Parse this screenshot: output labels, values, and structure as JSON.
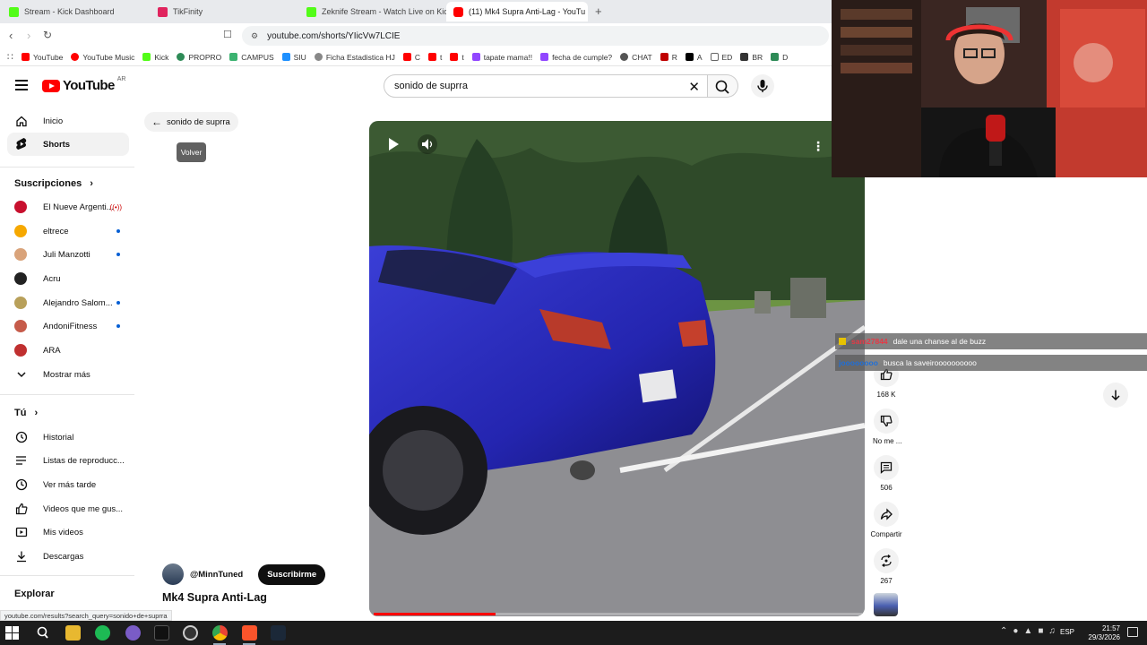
{
  "browser": {
    "tabs": [
      {
        "title": "Stream - Kick Dashboard",
        "favicon_color": "#1f1f1f"
      },
      {
        "title": "TikFinity",
        "favicon_color": "#e0245e"
      },
      {
        "title": "Zeknife Stream - Watch Live on Kick",
        "favicon_color": "#1f1f1f"
      },
      {
        "title": "(11) Mk4 Supra Anti-Lag - YouTu",
        "favicon_color": "#ff0000"
      }
    ],
    "url": "youtube.com/shorts/YIicVw7LCIE",
    "bookmarks": [
      {
        "label": "YouTube",
        "color": "#ff0000"
      },
      {
        "label": "YouTube Music",
        "color": "#ff0000"
      },
      {
        "label": "Kick",
        "color": "#53fc18"
      },
      {
        "label": "PROPRO",
        "color": "#2e8b57"
      },
      {
        "label": "CAMPUS",
        "color": "#3cb371"
      },
      {
        "label": "SIU",
        "color": "#1e90ff"
      },
      {
        "label": "Ficha Estadistica HJ",
        "color": "#888888"
      },
      {
        "label": "C",
        "color": "#ff0000"
      },
      {
        "label": "t",
        "color": "#ff0000"
      },
      {
        "label": "t",
        "color": "#ff0000"
      },
      {
        "label": "tapate mama!!",
        "color": "#9146ff"
      },
      {
        "label": "fecha de cumple?",
        "color": "#9146ff"
      },
      {
        "label": "CHAT",
        "color": "#555555"
      },
      {
        "label": "R",
        "color": "#c00000"
      },
      {
        "label": "A",
        "color": "#000000"
      },
      {
        "label": "ED",
        "color": "#666666"
      },
      {
        "label": "BR",
        "color": "#333333"
      },
      {
        "label": "D",
        "color": "#2e8b57"
      }
    ]
  },
  "youtube": {
    "logo_text": "YouTube",
    "country": "AR",
    "search_value": "sonido de suprra",
    "back_chip_label": "sonido de suprra",
    "tooltip": "Volver"
  },
  "sidebar": {
    "main": [
      {
        "label": "Inicio",
        "icon": "home-icon",
        "active": false
      },
      {
        "label": "Shorts",
        "icon": "shorts-icon",
        "active": true
      }
    ],
    "subscriptions_title": "Suscripciones",
    "subscriptions": [
      {
        "label": "El Nueve Argenti...",
        "color": "#c8102e",
        "badge": "live"
      },
      {
        "label": "eltrece",
        "color": "#f6a800",
        "badge": "dot"
      },
      {
        "label": "Juli Manzotti",
        "color": "#d9a37a",
        "badge": "dot"
      },
      {
        "label": "Acru",
        "color": "#222222",
        "badge": "none"
      },
      {
        "label": "Alejandro Salom...",
        "color": "#b8a05a",
        "badge": "dot"
      },
      {
        "label": "AndoniFitness",
        "color": "#c65b4a",
        "badge": "dot"
      },
      {
        "label": "ARA",
        "color": "#c03030",
        "badge": "none"
      }
    ],
    "show_more": "Mostrar más",
    "you_title": "Tú",
    "you_items": [
      {
        "label": "Historial",
        "icon": "history-icon"
      },
      {
        "label": "Listas de reproducc...",
        "icon": "playlist-icon"
      },
      {
        "label": "Ver más tarde",
        "icon": "clock-icon"
      },
      {
        "label": "Videos que me gus...",
        "icon": "thumb-up-icon"
      },
      {
        "label": "Mis videos",
        "icon": "video-icon"
      },
      {
        "label": "Descargas",
        "icon": "download-icon"
      }
    ],
    "explore_title": "Explorar"
  },
  "short": {
    "channel": "@MinnTuned",
    "subscribe_label": "Suscribirme",
    "title": "Mk4 Supra Anti-Lag",
    "progress": 0.25
  },
  "actions": {
    "likes": "168 K",
    "dislike_label": "No me ...",
    "comments": "506",
    "share_label": "Compartir",
    "remix": "267"
  },
  "chat": [
    {
      "user": "sam27844",
      "message": "dale una chanse al de buzz",
      "user_color": "#e63946"
    },
    {
      "user": "joooooooo",
      "message": "busca la saveiroooooooooo",
      "user_color": "#1e6fd9"
    }
  ],
  "status_url": "youtube.com/results?search_query=sonido+de+suprra",
  "taskbar": {
    "language": "ESP",
    "time": "21:57",
    "date": "29/3/2026"
  }
}
